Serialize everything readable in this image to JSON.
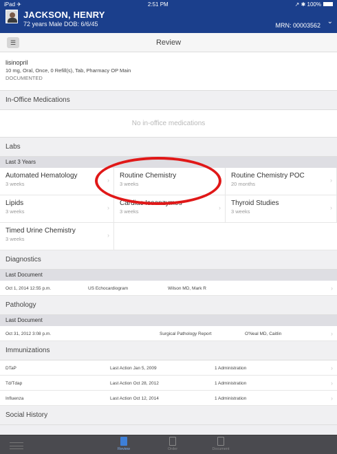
{
  "status": {
    "left": "iPad ✈",
    "time": "2:51 PM",
    "right": "↗ ✱ 100%"
  },
  "patient": {
    "name": "JACKSON, HENRY",
    "info": "72 years  Male  DOB: 6/6/45",
    "mrn": "MRN: 00003562"
  },
  "nav": {
    "title": "Review"
  },
  "medication": {
    "name": "lisinopril",
    "detail": "10 mg, Oral, Once, 0 Refill(s), Tab, Pharmacy OP Main",
    "status": "DOCUMENTED"
  },
  "in_office": {
    "header": "In-Office Medications",
    "empty": "No in-office medications"
  },
  "labs": {
    "header": "Labs",
    "subheader": "Last 3 Years",
    "items": [
      {
        "title": "Automated Hematology",
        "when": "3 weeks"
      },
      {
        "title": "Routine Chemistry",
        "when": "3 weeks"
      },
      {
        "title": "Routine Chemistry POC",
        "when": "20 months"
      },
      {
        "title": "Lipids",
        "when": "3 weeks"
      },
      {
        "title": "Cardiac Isoenzymes",
        "when": "3 weeks"
      },
      {
        "title": "Thyroid Studies",
        "when": "3 weeks"
      },
      {
        "title": "Timed Urine Chemistry",
        "when": "3 weeks"
      }
    ]
  },
  "diagnostics": {
    "header": "Diagnostics",
    "subheader": "Last Document",
    "date": "Oct 1, 2014 12:55 p.m.",
    "doc": "US Echocardiogram",
    "author": "Wilson MD, Mark R"
  },
  "pathology": {
    "header": "Pathology",
    "subheader": "Last Document",
    "date": "Oct 31, 2012 3:08 p.m.",
    "doc": "Surgical Pathology Report",
    "author": "O'Neal MD, Caitlin"
  },
  "immunizations": {
    "header": "Immunizations",
    "rows": [
      {
        "name": "DTaP",
        "action": "Last Action Jan 5, 2009",
        "count": "1 Administration"
      },
      {
        "name": "Td/Tdap",
        "action": "Last Action Oct 28, 2012",
        "count": "1 Administration"
      },
      {
        "name": "Influenza",
        "action": "Last Action Oct 12, 2014",
        "count": "1 Administration"
      }
    ]
  },
  "social": {
    "header": "Social History"
  },
  "tabs": {
    "review": "Review",
    "order": "Order",
    "document": "Document"
  },
  "colors": {
    "header_blue": "#1b3f8c",
    "annotation_red": "#e01818",
    "active_tab": "#3d7fd8"
  }
}
